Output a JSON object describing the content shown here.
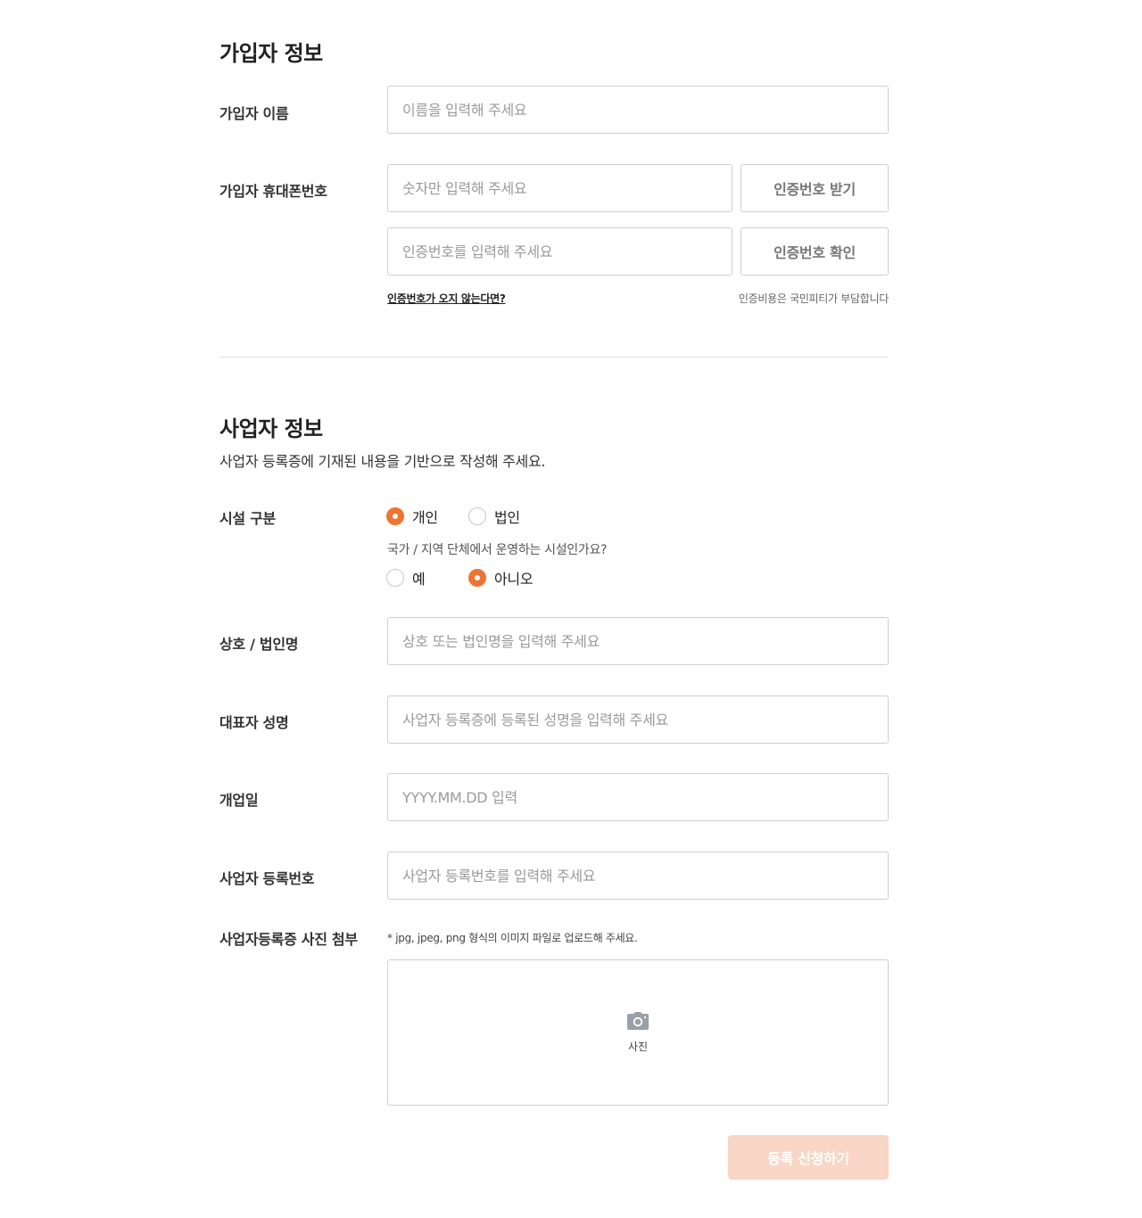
{
  "subscriber": {
    "title": "가입자 정보",
    "name_label": "가입자 이름",
    "name_placeholder": "이름을 입력해 주세요",
    "phone_label": "가입자 휴대폰번호",
    "phone_placeholder": "숫자만 입력해 주세요",
    "get_code_button": "인증번호 받기",
    "code_placeholder": "인증번호를 입력해 주세요",
    "verify_code_button": "인증번호 확인",
    "no_code_link": "인증번호가 오지 않는다면?",
    "cost_note": "인증비용은 국민피티가 부담합니다"
  },
  "business": {
    "title": "사업자 정보",
    "description": "사업자 등록증에 기재된 내용을 기반으로 작성해 주세요.",
    "facility_type_label": "시설 구분",
    "facility_options": [
      {
        "label": "개인",
        "checked": true
      },
      {
        "label": "법인",
        "checked": false
      }
    ],
    "public_question": "국가 / 지역 단체에서 운영하는 시설인가요?",
    "public_options": [
      {
        "label": "예",
        "checked": false
      },
      {
        "label": "아니오",
        "checked": true
      }
    ],
    "company_name_label": "상호 / 법인명",
    "company_name_placeholder": "상호 또는 법인명을 입력해 주세요",
    "representative_label": "대표자 성명",
    "representative_placeholder": "사업자 등록증에 등록된 성명을 입력해 주세요",
    "open_date_label": "개업일",
    "open_date_placeholder": "YYYY.MM.DD 입력",
    "reg_number_label": "사업자 등록번호",
    "reg_number_placeholder": "사업자 등록번호를 입력해 주세요",
    "photo_label": "사업자등록증 사진 첨부",
    "photo_note": "* jpg, jpeg, png 형식의 이미지 파일로 업로드해 주세요.",
    "photo_upload_text": "사진",
    "photo_icon": "camera-icon"
  },
  "submit_button": "등록 신청하기",
  "colors": {
    "accent": "#ee7433",
    "submit_disabled_bg": "#f9d6c5"
  }
}
